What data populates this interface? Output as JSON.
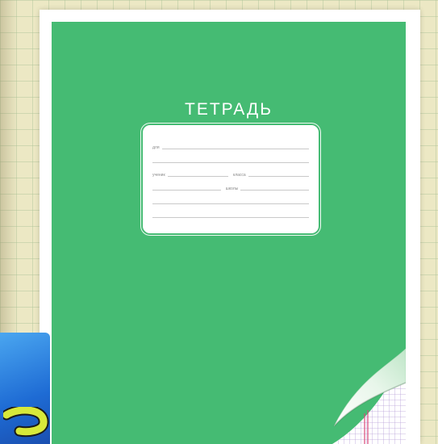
{
  "notebook": {
    "title": "ТЕТРАДЬ",
    "label_words": {
      "for": "для",
      "student": "ученик",
      "class": "класса",
      "school": "школы"
    }
  },
  "colors": {
    "cover": "#45bb73",
    "background": "#ece8c4",
    "curl_grid": "#b7a0d8",
    "curl_margin": "#d84a7a"
  }
}
